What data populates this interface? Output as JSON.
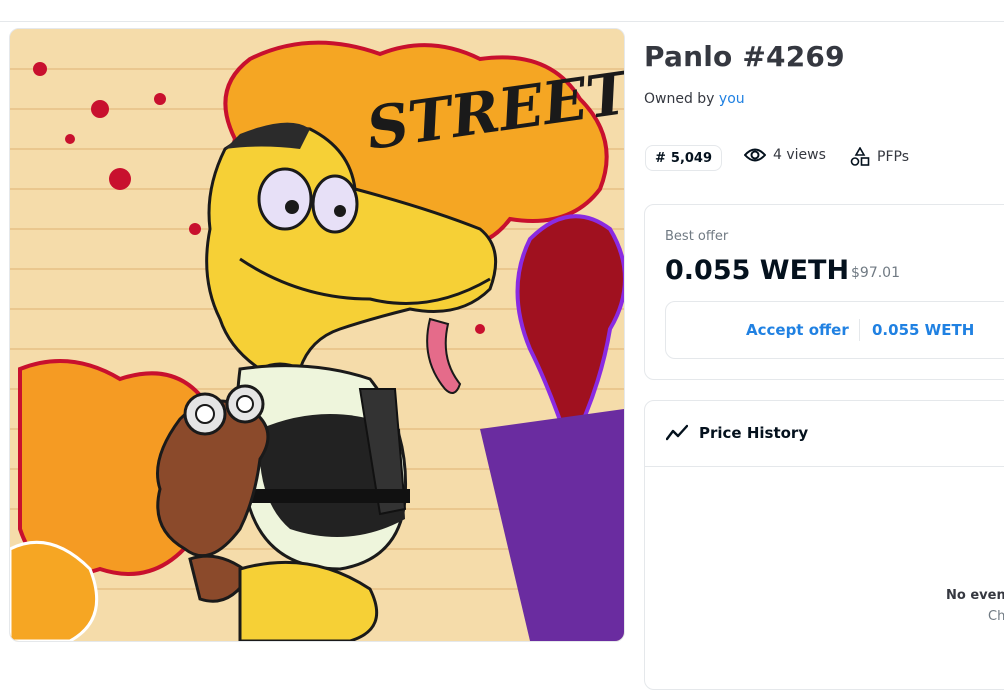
{
  "item": {
    "title": "Panlo #4269",
    "owned_prefix": "Owned by ",
    "owner": "you"
  },
  "stats": {
    "rank": "5,049",
    "views": "4 views",
    "category": "PFPs"
  },
  "offer": {
    "label": "Best offer",
    "price": "0.055 WETH",
    "usd": "$97.01",
    "accept_label": "Accept offer",
    "accept_amount": "0.055 WETH"
  },
  "price_history": {
    "title": "Price History",
    "empty_title": "No even",
    "empty_sub": "Ch"
  },
  "artwork": {
    "graffiti_text": "STREET"
  },
  "colors": {
    "accent": "#2081e2",
    "text": "#04111d",
    "muted": "#707a83",
    "border": "#e5e8eb"
  }
}
